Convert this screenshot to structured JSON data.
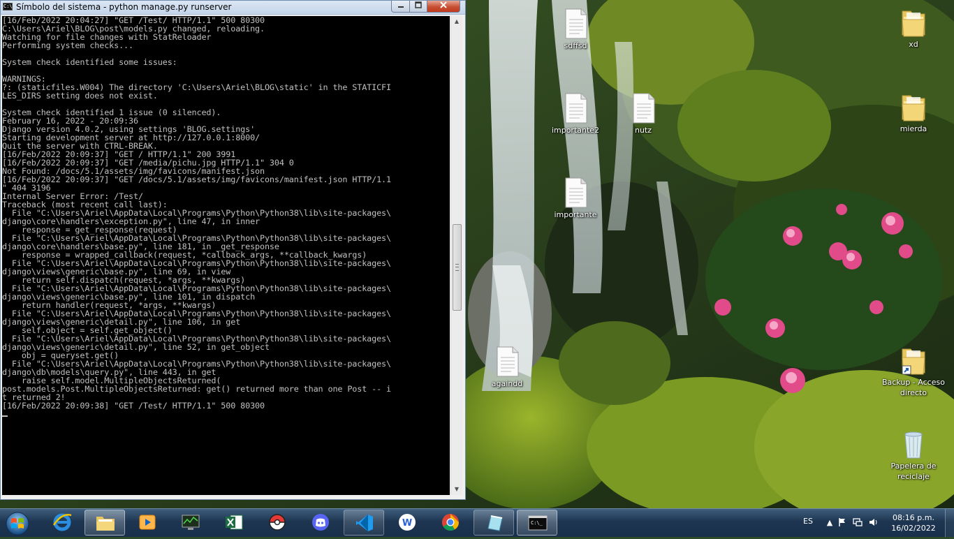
{
  "console": {
    "title": "Símbolo del sistema - python  manage.py runserver",
    "icon_text": "C:\\",
    "lines": [
      "[16/Feb/2022 20:04:27] \"GET /Test/ HTTP/1.1\" 500 80300",
      "C:\\Users\\Ariel\\BLOG\\post\\models.py changed, reloading.",
      "Watching for file changes with StatReloader",
      "Performing system checks...",
      "",
      "System check identified some issues:",
      "",
      "WARNINGS:",
      "?: (staticfiles.W004) The directory 'C:\\Users\\Ariel\\BLOG\\static' in the STATICFI",
      "LES_DIRS setting does not exist.",
      "",
      "System check identified 1 issue (0 silenced).",
      "February 16, 2022 - 20:09:36",
      "Django version 4.0.2, using settings 'BLOG.settings'",
      "Starting development server at http://127.0.0.1:8000/",
      "Quit the server with CTRL-BREAK.",
      "[16/Feb/2022 20:09:37] \"GET / HTTP/1.1\" 200 3991",
      "[16/Feb/2022 20:09:37] \"GET /media/pichu.jpg HTTP/1.1\" 304 0",
      "Not Found: /docs/5.1/assets/img/favicons/manifest.json",
      "[16/Feb/2022 20:09:37] \"GET /docs/5.1/assets/img/favicons/manifest.json HTTP/1.1",
      "\" 404 3196",
      "Internal Server Error: /Test/",
      "Traceback (most recent call last):",
      "  File \"C:\\Users\\Ariel\\AppData\\Local\\Programs\\Python\\Python38\\lib\\site-packages\\",
      "django\\core\\handlers\\exception.py\", line 47, in inner",
      "    response = get_response(request)",
      "  File \"C:\\Users\\Ariel\\AppData\\Local\\Programs\\Python\\Python38\\lib\\site-packages\\",
      "django\\core\\handlers\\base.py\", line 181, in _get_response",
      "    response = wrapped_callback(request, *callback_args, **callback_kwargs)",
      "  File \"C:\\Users\\Ariel\\AppData\\Local\\Programs\\Python\\Python38\\lib\\site-packages\\",
      "django\\views\\generic\\base.py\", line 69, in view",
      "    return self.dispatch(request, *args, **kwargs)",
      "  File \"C:\\Users\\Ariel\\AppData\\Local\\Programs\\Python\\Python38\\lib\\site-packages\\",
      "django\\views\\generic\\base.py\", line 101, in dispatch",
      "    return handler(request, *args, **kwargs)",
      "  File \"C:\\Users\\Ariel\\AppData\\Local\\Programs\\Python\\Python38\\lib\\site-packages\\",
      "django\\views\\generic\\detail.py\", line 106, in get",
      "    self.object = self.get_object()",
      "  File \"C:\\Users\\Ariel\\AppData\\Local\\Programs\\Python\\Python38\\lib\\site-packages\\",
      "django\\views\\generic\\detail.py\", line 52, in get_object",
      "    obj = queryset.get()",
      "  File \"C:\\Users\\Ariel\\AppData\\Local\\Programs\\Python\\Python38\\lib\\site-packages\\",
      "django\\db\\models\\query.py\", line 443, in get",
      "    raise self.model.MultipleObjectsReturned(",
      "post.models.Post.MultipleObjectsReturned: get() returned more than one Post -- i",
      "t returned 2!",
      "[16/Feb/2022 20:09:38] \"GET /Test/ HTTP/1.1\" 500 80300"
    ]
  },
  "desktop_icons": [
    {
      "label": "sdffsd",
      "type": "file"
    },
    {
      "label": "xd",
      "type": "folder"
    },
    {
      "label": "importante2",
      "type": "file"
    },
    {
      "label": "nutz",
      "type": "file"
    },
    {
      "label": "mierda",
      "type": "folder"
    },
    {
      "label": "importante",
      "type": "file"
    },
    {
      "label": "againdd",
      "type": "file"
    },
    {
      "label": "Backup - Acceso directo",
      "type": "folder-shortcut"
    },
    {
      "label": "Papelera de reciclaje",
      "type": "recycle-bin"
    }
  ],
  "taskbar": {
    "apps": [
      {
        "icon": "internet-explorer-icon"
      },
      {
        "icon": "file-explorer-icon"
      },
      {
        "icon": "media-center-icon"
      },
      {
        "icon": "task-manager-icon"
      },
      {
        "icon": "excel-icon"
      },
      {
        "icon": "pokeball-icon"
      },
      {
        "icon": "discord-icon"
      },
      {
        "icon": "vscode-icon"
      },
      {
        "icon": "w-app-icon"
      },
      {
        "icon": "chrome-icon"
      },
      {
        "icon": "notes-app-icon"
      },
      {
        "icon": "command-prompt-icon"
      }
    ],
    "language": "ES",
    "time": "08:16 p.m.",
    "date": "16/02/2022"
  },
  "colors": {
    "terminal_bg": "#000000",
    "terminal_fg": "#c0c0c0",
    "taskbar": "#1d3550",
    "close_button": "#c74f33"
  }
}
